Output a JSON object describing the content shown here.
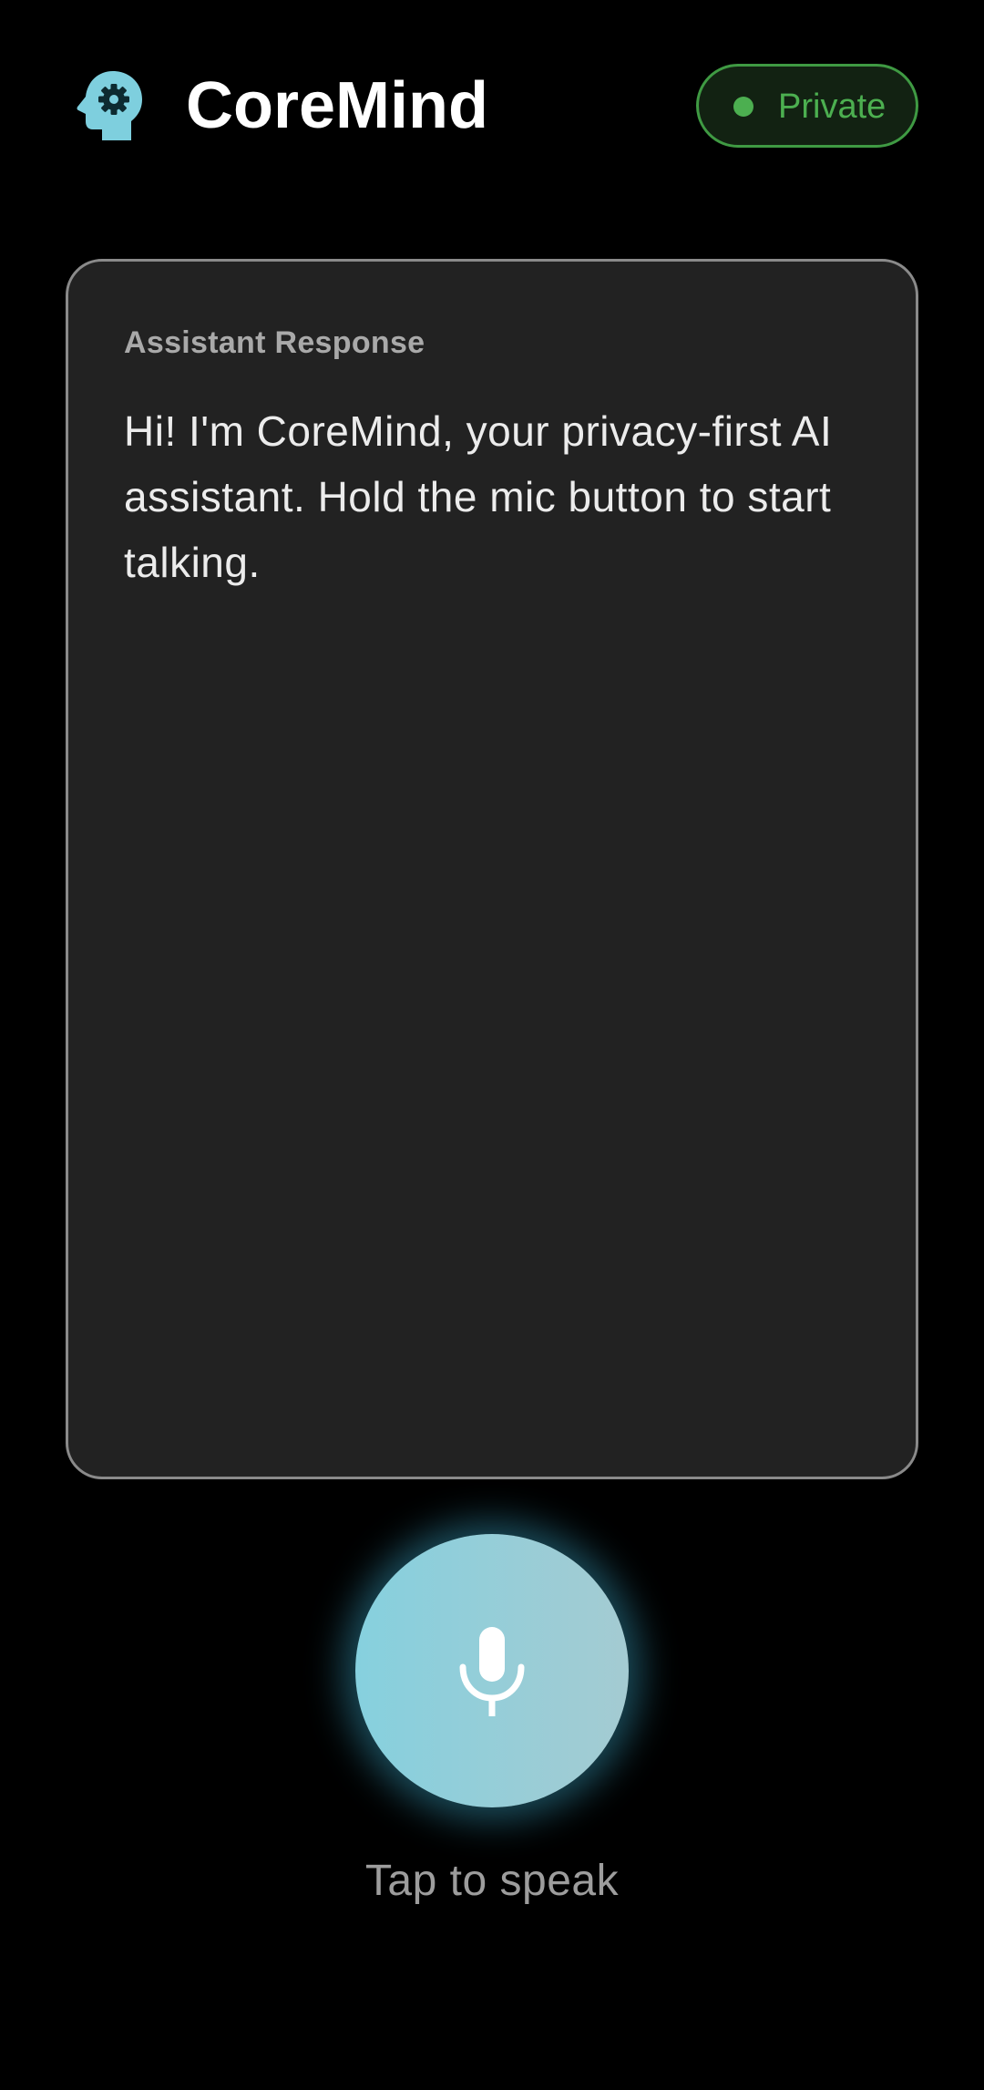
{
  "header": {
    "logo_icon": "head-gear-icon",
    "title": "CoreMind",
    "privacy_badge": {
      "label": "Private",
      "status_color": "#4caf50"
    }
  },
  "response_card": {
    "label": "Assistant Response",
    "text": "Hi! I'm CoreMind, your privacy-first AI assistant. Hold the mic button to start talking."
  },
  "mic": {
    "icon": "microphone-icon",
    "hint": "Tap to speak",
    "accent_color": "#86d0de"
  },
  "colors": {
    "background": "#000000",
    "card": "#222222",
    "logo": "#7ecfde"
  }
}
